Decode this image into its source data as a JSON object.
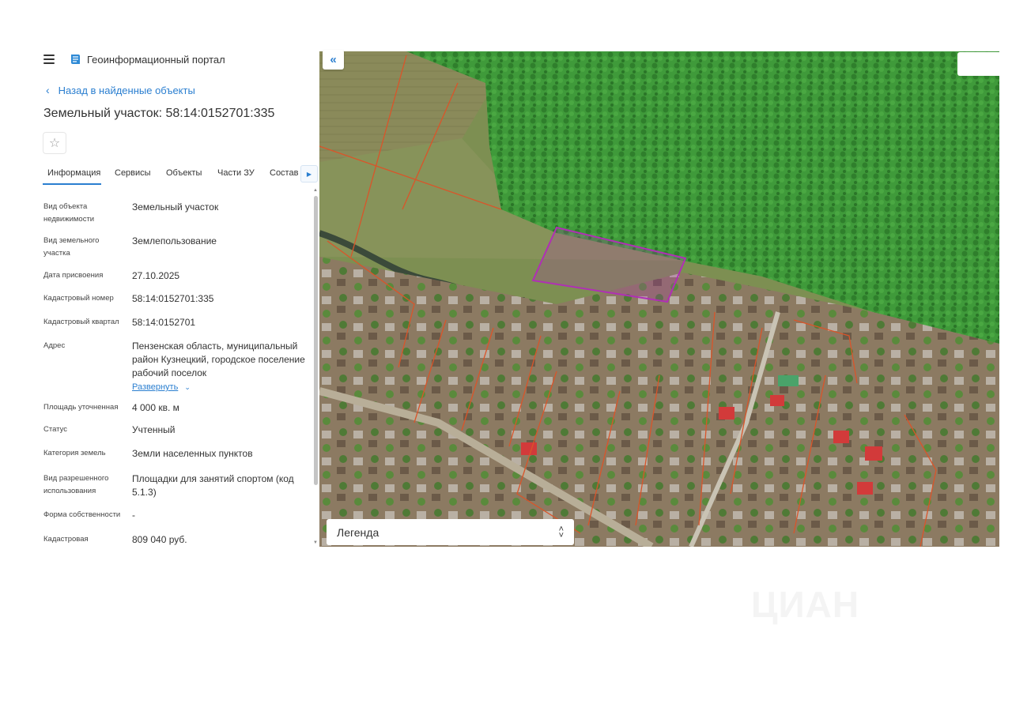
{
  "header": {
    "portal_title": "Геоинформационный портал",
    "icons": [
      "menu-icon",
      "portal-logo-icon"
    ]
  },
  "nav": {
    "back_label": "Назад в найденные объекты"
  },
  "page": {
    "title": "Земельный участок: 58:14:0152701:335"
  },
  "tabs": [
    {
      "label": "Информация",
      "active": true
    },
    {
      "label": "Сервисы",
      "active": false
    },
    {
      "label": "Объекты",
      "active": false
    },
    {
      "label": "Части ЗУ",
      "active": false
    },
    {
      "label": "Состав",
      "active": false
    }
  ],
  "fields": [
    {
      "label": "Вид объекта недвижимости",
      "value": "Земельный участок"
    },
    {
      "label": "Вид земельного участка",
      "value": "Землепользование"
    },
    {
      "label": "Дата присвоения",
      "value": "27.10.2025"
    },
    {
      "label": "Кадастровый номер",
      "value": "58:14:0152701:335"
    },
    {
      "label": "Кадастровый квартал",
      "value": "58:14:0152701"
    },
    {
      "label": "Адрес",
      "value": "Пензенская область, муниципальный район Кузнецкий, городское поселение рабочий поселок",
      "expand_label": "Развернуть"
    },
    {
      "label": "Площадь уточненная",
      "value": "4 000 кв. м"
    },
    {
      "label": "Статус",
      "value": "Учтенный"
    },
    {
      "label": "Категория земель",
      "value": "Земли населенных пунктов"
    },
    {
      "label": "Вид разрешенного использования",
      "value": "Площадки для занятий спортом (код 5.1.3)"
    },
    {
      "label": "Форма собственности",
      "value": "-"
    },
    {
      "label": "Кадастровая",
      "value": "809 040 руб."
    }
  ],
  "map": {
    "collapse_symbol": "«",
    "legend_label": "Легенда",
    "parcel_outline_color": "#b02fb5",
    "boundary_color": "#d9552a",
    "forest_color": "#3f9a3a"
  },
  "watermark": "ЦИАН"
}
